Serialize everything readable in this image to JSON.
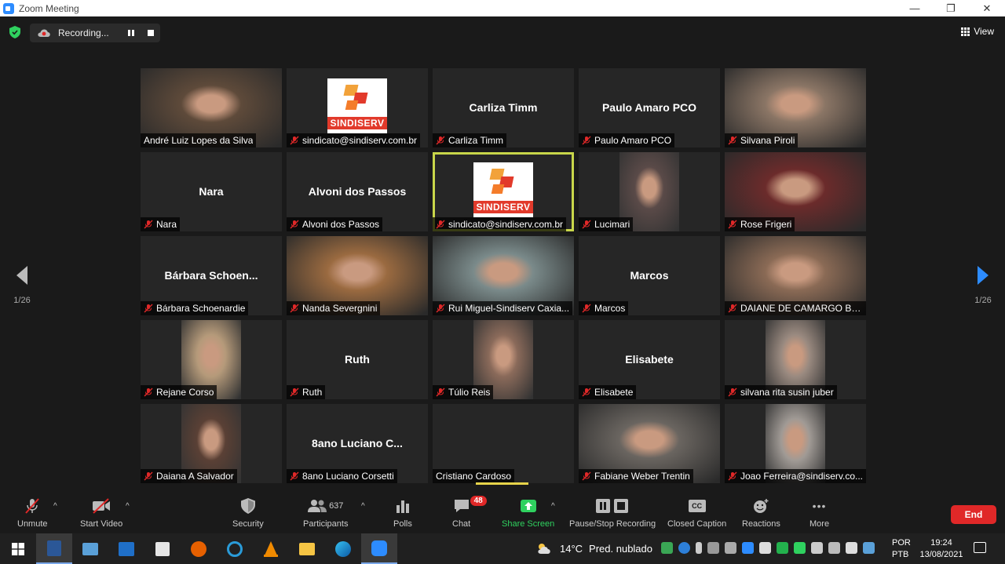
{
  "window": {
    "title": "Zoom Meeting",
    "minimize": "—",
    "maximize": "❐",
    "close": "✕"
  },
  "header": {
    "recording_label": "Recording...",
    "view_label": "View"
  },
  "nav": {
    "page_left": "1/26",
    "page_right": "1/26"
  },
  "participants": [
    {
      "name": "André Luiz Lopes da Silva",
      "kind": "video",
      "muted": false,
      "bg": "#5e4a3a"
    },
    {
      "name": "sindicato@sindiserv.com.br",
      "kind": "logo",
      "muted": true
    },
    {
      "name": "Carliza Timm",
      "display": "Carliza Timm",
      "kind": "name",
      "muted": true
    },
    {
      "name": "Paulo Amaro PCO",
      "display": "Paulo Amaro PCO",
      "kind": "name",
      "muted": true
    },
    {
      "name": "Silvana Piroli",
      "kind": "video",
      "muted": true,
      "bg": "#8a7565"
    },
    {
      "name": "Nara",
      "display": "Nara",
      "kind": "name",
      "muted": true
    },
    {
      "name": "Alvoni dos Passos",
      "display": "Alvoni dos Passos",
      "kind": "name",
      "muted": true
    },
    {
      "name": "sindicato@sindiserv.com.br",
      "kind": "logo",
      "muted": true,
      "active": true
    },
    {
      "name": "Lucimari",
      "kind": "video-narrow",
      "muted": true,
      "bg": "#5a4a48"
    },
    {
      "name": "Rose Frigeri",
      "kind": "video",
      "muted": true,
      "bg": "#6b2b2b"
    },
    {
      "name": "Bárbara Schoenardie",
      "display": "Bárbara  Schoen...",
      "kind": "name",
      "muted": true
    },
    {
      "name": "Nanda Severgnini",
      "kind": "video",
      "muted": true,
      "bg": "#9a6a40"
    },
    {
      "name": "Rui Miguel-Sindiserv Caxia...",
      "kind": "video",
      "muted": true,
      "bg": "#7a8a8a"
    },
    {
      "name": "Marcos",
      "display": "Marcos",
      "kind": "name",
      "muted": true
    },
    {
      "name": "DAIANE DE CAMARGO BU...",
      "kind": "video",
      "muted": true,
      "bg": "#8a6a55"
    },
    {
      "name": "Rejane Corso",
      "kind": "video-narrow",
      "muted": true,
      "bg": "#b59a7a"
    },
    {
      "name": "Ruth",
      "display": "Ruth",
      "kind": "name",
      "muted": true
    },
    {
      "name": "Túlio Reis",
      "kind": "video-narrow",
      "muted": true,
      "bg": "#8a6a5a"
    },
    {
      "name": "Elisabete",
      "display": "Elisabete",
      "kind": "name",
      "muted": true
    },
    {
      "name": "silvana rita susin juber",
      "kind": "video-narrow",
      "muted": true,
      "bg": "#9a8a80"
    },
    {
      "name": "Daiana A Salvador",
      "kind": "video-narrow",
      "muted": true,
      "bg": "#5a4035"
    },
    {
      "name": "8ano Luciano Corsetti",
      "display": "8ano  Luciano  C...",
      "kind": "name",
      "muted": true
    },
    {
      "name": "Cristiano Cardoso",
      "kind": "blank",
      "muted": false
    },
    {
      "name": "Fabiane Weber Trentin",
      "kind": "video",
      "muted": true,
      "bg": "#6a6560"
    },
    {
      "name": "Joao Ferreira@sindiserv.co...",
      "kind": "video-narrow",
      "muted": true,
      "bg": "#a09a95"
    }
  ],
  "toolbar": {
    "unmute": "Unmute",
    "start_video": "Start Video",
    "security": "Security",
    "participants": "Participants",
    "participants_count": "637",
    "polls": "Polls",
    "chat": "Chat",
    "chat_badge": "48",
    "share_screen": "Share Screen",
    "pause_stop_recording": "Pause/Stop Recording",
    "closed_caption": "Closed Caption",
    "reactions": "Reactions",
    "more": "More",
    "end": "End",
    "cc_glyph": "CC",
    "more_glyph": "•••"
  },
  "taskbar": {
    "weather_temp": "14°C",
    "weather_desc": "Pred. nublado",
    "lang_1": "POR",
    "lang_2": "PTB",
    "time": "19:24",
    "date": "13/08/2021"
  },
  "colors": {
    "active_speaker": "#c8d64a",
    "end_button": "#e02828",
    "share_green": "#2fd15f",
    "mute_red": "#e02828"
  }
}
